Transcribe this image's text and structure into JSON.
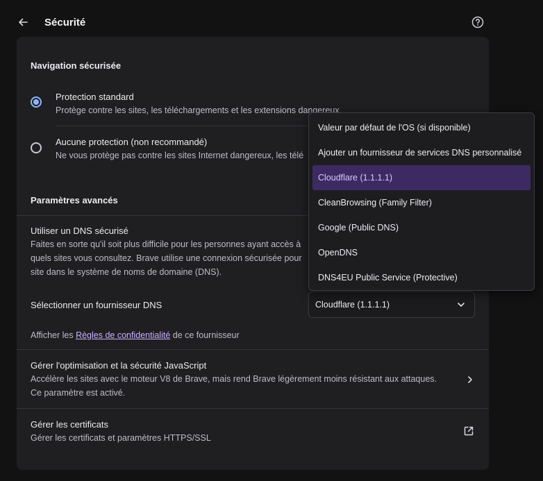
{
  "header": {
    "title": "Sécurité"
  },
  "safe_browsing": {
    "title": "Navigation sécurisée",
    "options": [
      {
        "label": "Protection standard",
        "desc": "Protège contre les sites, les téléchargements et les extensions dangereux.",
        "checked": true
      },
      {
        "label": "Aucune protection (non recommandé)",
        "desc": "Ne vous protège pas contre les sites Internet dangereux, les télé",
        "checked": false
      }
    ]
  },
  "advanced": {
    "title": "Paramètres avancés",
    "dns": {
      "title": "Utiliser un DNS sécurisé",
      "desc_line1": "Faites en sorte qu'il soit plus difficile pour les personnes ayant accès à",
      "desc_line2": "quels sites vous consultez. Brave utilise une connexion sécurisée pour",
      "desc_line3": "site dans le système de noms de domaine (DNS).",
      "provider_label": "Sélectionner un fournisseur DNS",
      "selected_provider": "Cloudflare (1.1.1.1)",
      "privacy_prefix": "Afficher les ",
      "privacy_link": "Règles de confidentialité",
      "privacy_suffix": " de ce fournisseur"
    },
    "javascript": {
      "title": "Gérer l'optimisation et la sécurité JavaScript",
      "desc_line1": "Accélère les sites avec le moteur V8 de Brave, mais rend Brave légèrement moins résistant aux attaques.",
      "desc_line2": "Ce paramètre est activé."
    },
    "certificates": {
      "title": "Gérer les certificats",
      "desc": "Gérer les certificats et paramètres HTTPS/SSL"
    }
  },
  "dropdown": {
    "items": [
      "Valeur par défaut de l'OS (si disponible)",
      "Ajouter un fournisseur de services DNS personnalisé",
      "Cloudflare (1.1.1.1)",
      "CleanBrowsing (Family Filter)",
      "Google (Public DNS)",
      "OpenDNS",
      "DNS4EU Public Service (Protective)"
    ],
    "selected_index": 2
  },
  "colors": {
    "accent_radio": "#8fb4ff",
    "link": "#c9b3ff",
    "selected_bg": "#3d2a63"
  }
}
